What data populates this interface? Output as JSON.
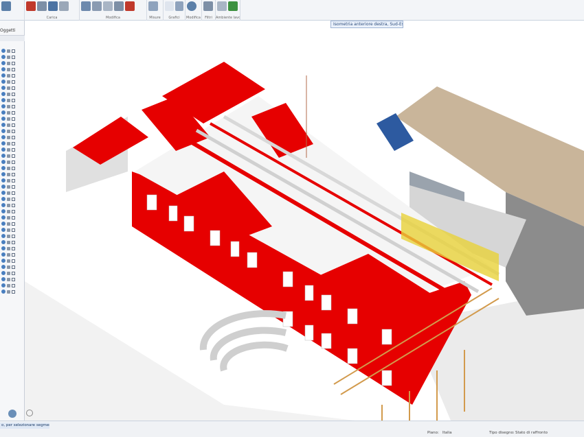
{
  "ribbon": {
    "groups": [
      {
        "label": ""
      },
      {
        "label": "Carica"
      },
      {
        "label": "Modifica"
      },
      {
        "label": "Misure"
      },
      {
        "label": "Grafici"
      },
      {
        "label": "Modifica"
      },
      {
        "label": "Filtri"
      },
      {
        "label": "Ambiente lavoro"
      }
    ]
  },
  "view_tooltip": "Isometria anteriore destra, Sud-Est",
  "panel": {
    "tab_label": "Oggetti"
  },
  "status": {
    "command_prompt": "o, per selezionare segmento",
    "piano_label": "Piano:",
    "piano_value": "Italia",
    "tipo_label": "Tipo disegno:",
    "tipo_value": "Stato di raffronto"
  },
  "colors": {
    "accent_red": "#e60000",
    "roof_brown": "#c9b59a",
    "structure_gray": "#d8d8d8"
  },
  "icons": [
    "save-icon",
    "pencil-icon",
    "line-icon",
    "copy-icon",
    "wave-icon",
    "mirror-icon",
    "text-icon",
    "measure-icon",
    "abc-icon",
    "pin-icon",
    "filter-icon",
    "layout-icon",
    "eye-icon",
    "lock-icon",
    "checkbox-icon",
    "gear-icon",
    "orbit-icon"
  ]
}
